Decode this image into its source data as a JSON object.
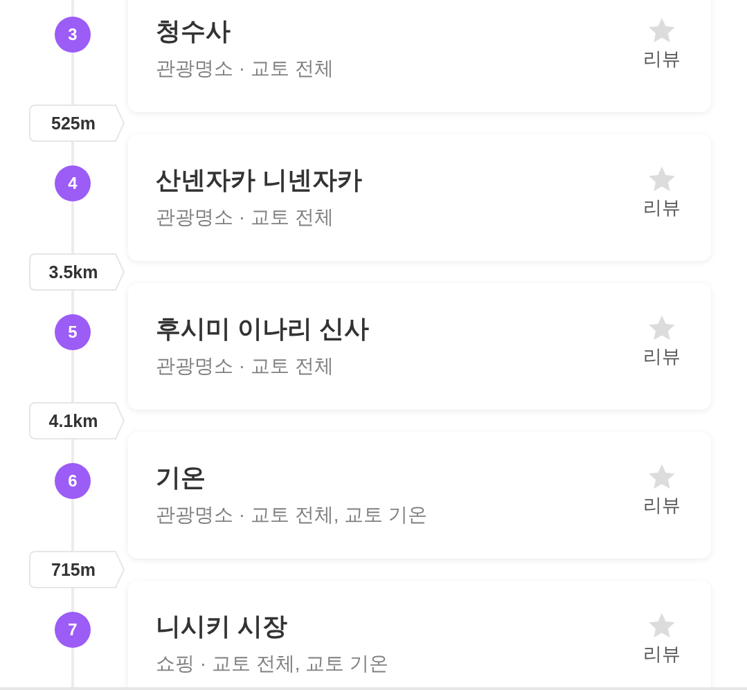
{
  "stops": [
    {
      "number": "3",
      "name": "청수사",
      "meta": "관광명소 · 교토 전체",
      "review": "리뷰",
      "distance_after": "525m"
    },
    {
      "number": "4",
      "name": "산넨자카 니넨자카",
      "meta": "관광명소 · 교토 전체",
      "review": "리뷰",
      "distance_after": "3.5km"
    },
    {
      "number": "5",
      "name": "후시미 이나리 신사",
      "meta": "관광명소 · 교토 전체",
      "review": "리뷰",
      "distance_after": "4.1km"
    },
    {
      "number": "6",
      "name": "기온",
      "meta": "관광명소 · 교토 전체, 교토 기온",
      "review": "리뷰",
      "distance_after": "715m"
    },
    {
      "number": "7",
      "name": "니시키 시장",
      "meta": "쇼핑 · 교토 전체, 교토 기온",
      "review": "리뷰"
    }
  ]
}
